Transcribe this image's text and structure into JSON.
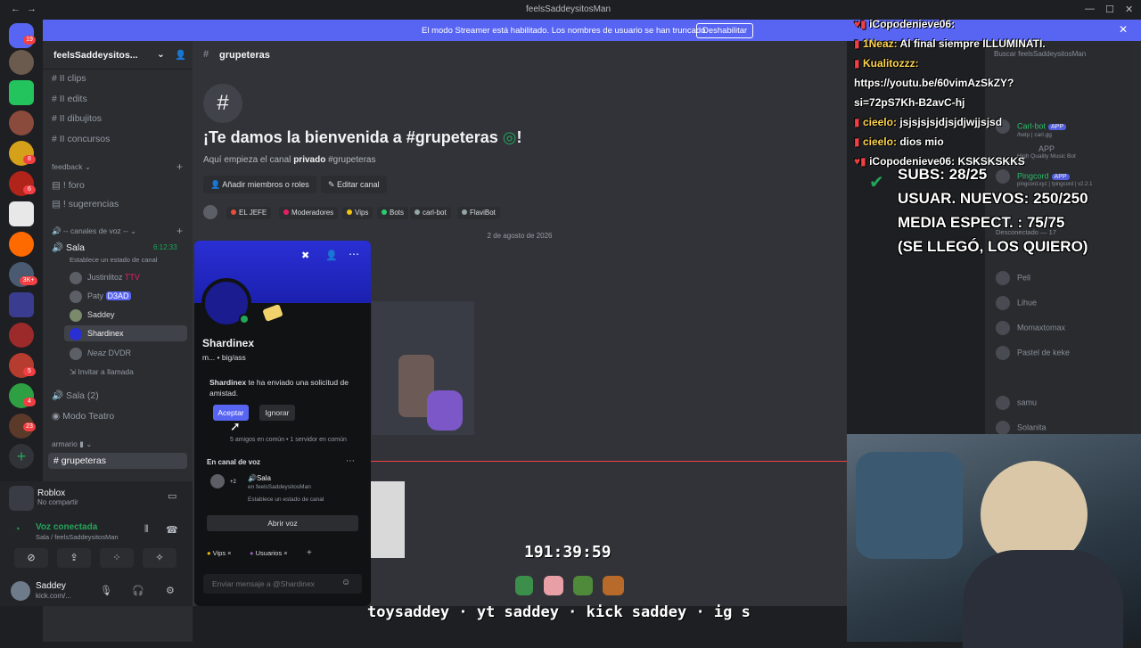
{
  "window": {
    "title": "feelsSaddeysitosMan"
  },
  "streamer_banner": {
    "message": "El modo Streamer está habilitado. Los nombres de usuario se han truncado.",
    "button": "Deshabilitar"
  },
  "guild_badges": [
    "19",
    "8",
    "6",
    "3K+",
    "5",
    "4",
    "1",
    "23"
  ],
  "server": {
    "name": "feelsSaddeysitos..."
  },
  "channels": {
    "top": [
      {
        "name": "clips",
        "emoji": "II"
      },
      {
        "name": "edits",
        "emoji": "II"
      },
      {
        "name": "dibujitos",
        "emoji": "II"
      },
      {
        "name": "concursos",
        "emoji": "II"
      }
    ],
    "feedback_cat": "feedback",
    "feedback": [
      {
        "name": "foro"
      },
      {
        "name": "sugerencias"
      }
    ],
    "voice_cat": "canales de voz",
    "voice_channel": {
      "name": "Sala",
      "time": "6:12:33",
      "status": "Establece un estado de canal"
    },
    "voice_users": [
      {
        "name": "Justinlitoz",
        "tag": "TTV"
      },
      {
        "name": "Paty",
        "tag": "D3AD"
      },
      {
        "name": "Saddey",
        "tag": ""
      },
      {
        "name": "Shardinex",
        "tag": ""
      },
      {
        "name": "Neaz",
        "tag": "DVDR"
      }
    ],
    "invite": "Invitar a llamada",
    "sala2": "Sala (2)",
    "teatro": "Modo Teatro",
    "armario_cat": "armario",
    "active": "grupeteras"
  },
  "activity": {
    "game": "Roblox",
    "sub": "No compartir"
  },
  "voice_connected": {
    "title": "Voz conectada",
    "sub": "Sala / feelsSaddeysitosMan"
  },
  "user": {
    "name": "Saddey",
    "status": "kick.com/..."
  },
  "main": {
    "channel": "grupeteras",
    "welcome_title": "¡Te damos la bienvenida a #grupeteras",
    "welcome_pre": "Aquí empieza el canal",
    "welcome_bold": "privado",
    "welcome_post": "#grupeteras",
    "add_members": "Añadir miembros o roles",
    "edit_channel": "Editar canal",
    "roles": [
      {
        "name": "EL JEFE",
        "color": "#e74c3c"
      },
      {
        "name": "Moderadores",
        "color": "#e91e63"
      },
      {
        "name": "Vips",
        "color": "#f1c40f"
      },
      {
        "name": "Bots",
        "color": "#2ecc71"
      },
      {
        "name": "carl-bot",
        "color": "#95a5a6"
      },
      {
        "name": "FlaviBot",
        "color": "#95a5a6"
      }
    ],
    "date": "2 de agosto de 2026",
    "message_placeholder": "Enviar mensaje a @Shardinex"
  },
  "popup": {
    "name": "Shardinex",
    "sub": "m... • big/ass",
    "request_bold": "Shardinex",
    "request_text": "te ha enviado una solicitud de amistad.",
    "accept": "Aceptar",
    "ignore": "Ignorar",
    "mutual": "5 amigos en común • 1 servidor en común",
    "voice_section": "En canal de voz",
    "voice_channel": "Sala",
    "voice_server": "en feelsSaddeysitosMan",
    "voice_status": "Establece un estado de canal",
    "voice_count": "+2",
    "open_voice": "Abrir voz",
    "tags": [
      {
        "name": "Vips",
        "color": "#f1c40f"
      },
      {
        "name": "Usuarios",
        "color": "#9b59b6"
      }
    ]
  },
  "search": {
    "placeholder": "Buscar feelsSaddeysitosMan"
  },
  "members": [
    {
      "name": "Carl-bot",
      "sub": "/help | carl.gg",
      "app": "APP"
    },
    {
      "name": "",
      "sub": "High Quality Music Bot",
      "app": "APP"
    },
    {
      "name": "Pingcord",
      "sub": "pingcord.xyz | !pingcord | v2.2.1",
      "app": "APP"
    },
    {
      "name": "Desconectado — 17",
      "sub": "",
      "app": ""
    },
    {
      "name": "Pell",
      "sub": "",
      "app": ""
    },
    {
      "name": "Lihue",
      "sub": "",
      "app": ""
    },
    {
      "name": "Momaxtomax",
      "sub": "",
      "app": ""
    },
    {
      "name": "Pastel de keke",
      "sub": "",
      "app": ""
    },
    {
      "name": "samu",
      "sub": "",
      "app": ""
    },
    {
      "name": "Solanita",
      "sub": "",
      "app": ""
    }
  ],
  "stream_chat": [
    {
      "user": "iCopodenieve06:",
      "msg": "",
      "color": "#ffffff"
    },
    {
      "user": "1Neaz:",
      "msg": "Al final siempre ILLUMINATI.",
      "color": "#ffd54f"
    },
    {
      "user": "Kualitozzz:",
      "msg": "",
      "color": "#ffd54f"
    },
    {
      "user": "",
      "msg": "https://youtu.be/60vimAzSkZY?",
      "color": "#ffffff"
    },
    {
      "user": "",
      "msg": "si=72pS7Kh-B2avC-hj",
      "color": "#ffffff"
    },
    {
      "user": "cieelo:",
      "msg": "jsjsjsjsjdjsjdjwjjsjsd",
      "color": "#ffd54f"
    },
    {
      "user": "cieelo:",
      "msg": "dios mio",
      "color": "#ffd54f"
    },
    {
      "user": "iCopodenieve06:",
      "msg": "KSKSKSKKS",
      "color": "#ffffff"
    }
  ],
  "stats": [
    "SUBS: 28/25",
    "USUAR. NUEVOS: 250/250",
    "MEDIA ESPECT. : 75/75",
    "(SE LLEGÓ, LOS QUIERO)"
  ],
  "timer": "191:39:59",
  "ticker": "toysaddey · yt saddey · kick saddey · ig s"
}
